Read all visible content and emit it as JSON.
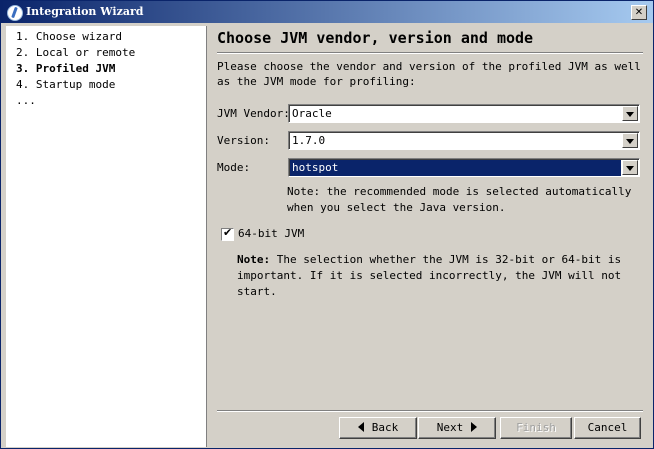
{
  "window": {
    "title": "Integration Wizard"
  },
  "steps": [
    {
      "label": "1. Choose wizard"
    },
    {
      "label": "2. Local or remote"
    },
    {
      "label": "3. Profiled JVM"
    },
    {
      "label": "4. Startup mode"
    },
    {
      "label": "..."
    }
  ],
  "page": {
    "heading": "Choose JVM vendor, version and mode",
    "description": "Please choose the vendor and version of the profiled JVM as well as the JVM mode for profiling:"
  },
  "fields": {
    "vendor": {
      "label": "JVM Vendor:",
      "value": "Oracle"
    },
    "version": {
      "label": "Version:",
      "value": "1.7.0"
    },
    "mode": {
      "label": "Mode:",
      "value": "hotspot"
    }
  },
  "mode_note": "Note: the recommended mode is selected automatically when you select the Java version.",
  "bitness": {
    "label": "64-bit JVM",
    "checked": true,
    "check_glyph": "✔"
  },
  "bitness_note": {
    "prefix": "Note:",
    "text": " The selection whether the JVM is 32-bit or 64-bit is important. If it is selected incorrectly, the JVM will not start."
  },
  "buttons": {
    "back": "Back",
    "next": "Next",
    "finish": "Finish",
    "cancel": "Cancel"
  },
  "icons": {
    "window": "wizard-icon",
    "close": "close-icon"
  }
}
